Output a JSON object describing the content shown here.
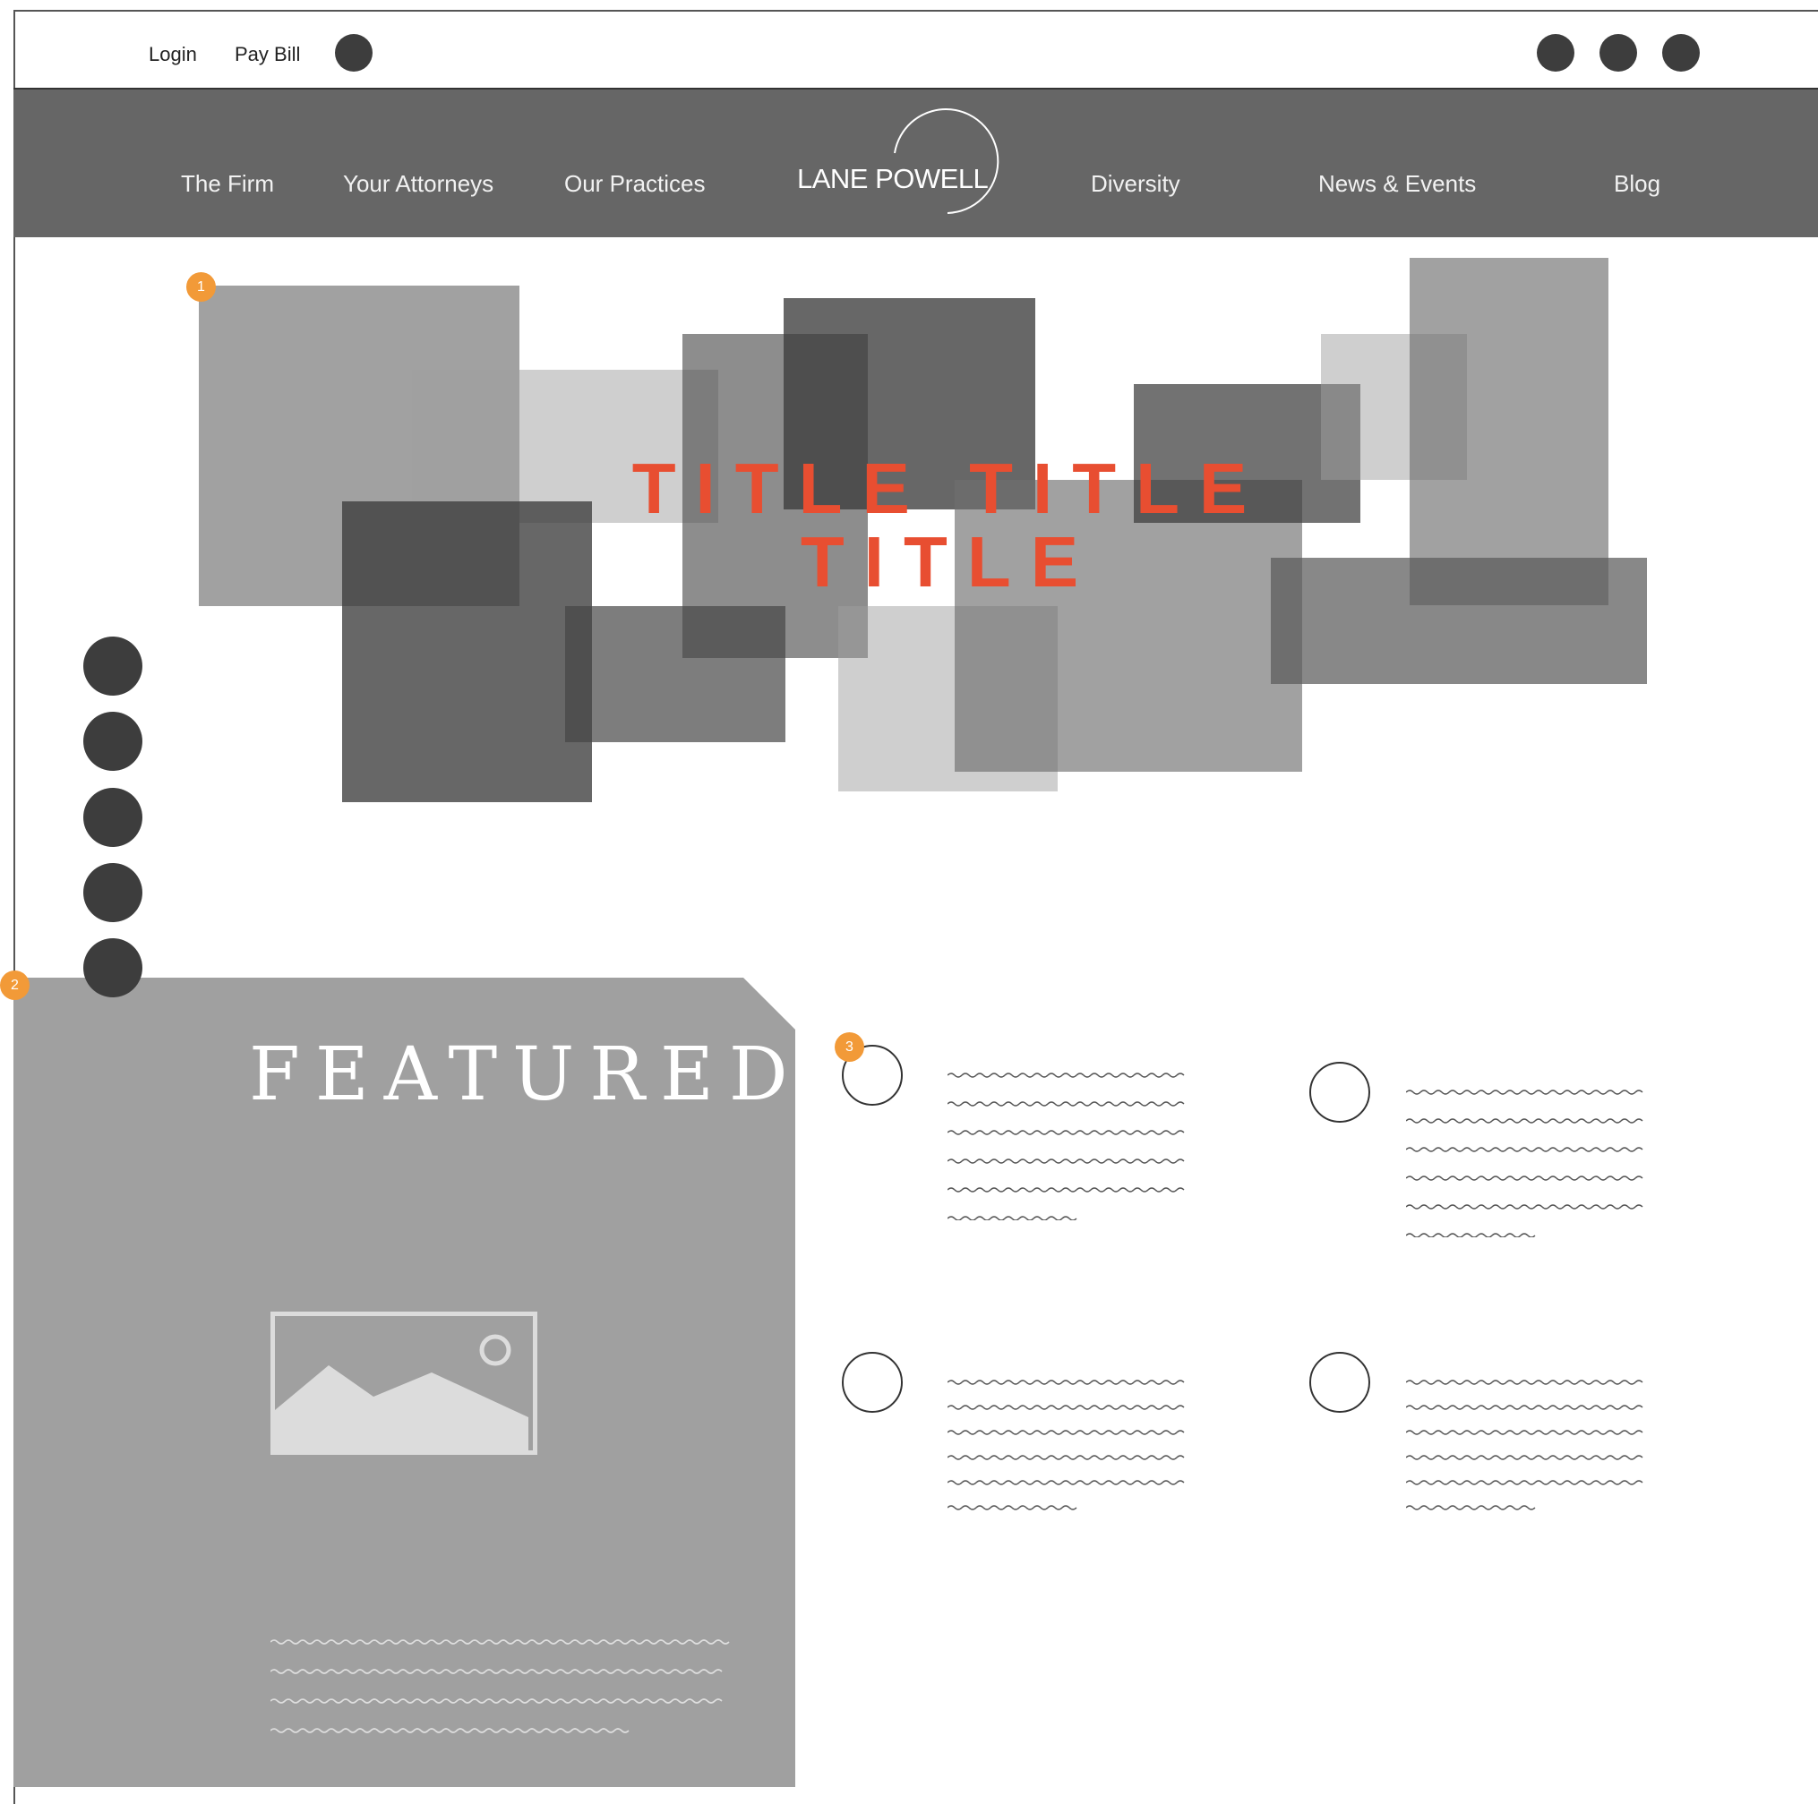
{
  "utility_bar": {
    "login_label": "Login",
    "pay_bill_label": "Pay Bill"
  },
  "nav": {
    "items_left": [
      "The Firm",
      "Your Attorneys",
      "Our Practices"
    ],
    "logo_text": "LANE POWELL",
    "items_right": [
      "Diversity",
      "News & Events",
      "Blog"
    ]
  },
  "hero": {
    "title_line1": "TITLE TITLE",
    "title_line2": "TITLE"
  },
  "markers": [
    "1",
    "2",
    "3"
  ],
  "featured": {
    "title": "FEATURED"
  },
  "colors": {
    "accent_red": "#e84e31",
    "marker_orange": "#f29a38",
    "nav_gray": "#666666",
    "dark_dot": "#3d3d3d"
  }
}
